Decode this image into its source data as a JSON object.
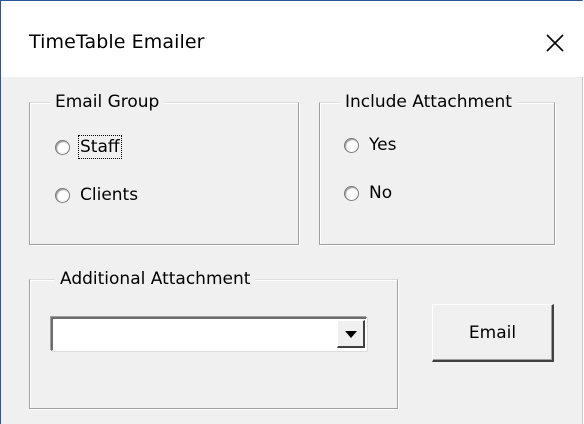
{
  "window": {
    "title": "TimeTable Emailer",
    "close_glyph": "close-icon"
  },
  "email_group": {
    "label": "Email Group",
    "options": [
      {
        "label": "Staff",
        "selected": false,
        "focused": true
      },
      {
        "label": "Clients",
        "selected": false,
        "focused": false
      }
    ]
  },
  "include_attachment": {
    "label": "Include Attachment",
    "options": [
      {
        "label": "Yes",
        "selected": false
      },
      {
        "label": "No",
        "selected": false
      }
    ]
  },
  "additional_attachment": {
    "label": "Additional Attachment",
    "value": ""
  },
  "actions": {
    "email_label": "Email"
  },
  "colors": {
    "dialog_bg": "#f0f0f0",
    "titlebar_bg": "#ffffff",
    "window_accent": "#2b579a"
  }
}
